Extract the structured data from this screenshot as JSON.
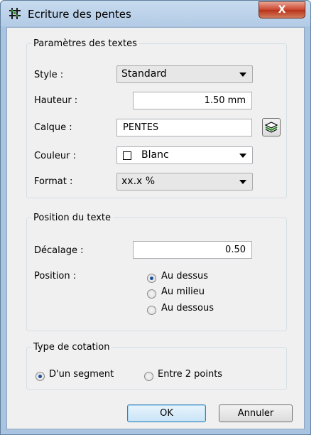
{
  "window": {
    "title": "Ecriture des pentes",
    "close_label": "X"
  },
  "params": {
    "legend": "Paramètres des textes",
    "style_label": "Style :",
    "style_value": "Standard",
    "hauteur_label": "Hauteur :",
    "hauteur_value": "1.50 mm",
    "calque_label": "Calque :",
    "calque_value": "PENTES",
    "couleur_label": "Couleur :",
    "couleur_value": "Blanc",
    "format_label": "Format :",
    "format_value": "xx.x %"
  },
  "position": {
    "legend": "Position du texte",
    "decalage_label": "Décalage :",
    "decalage_value": "0.50",
    "position_label": "Position :",
    "options": [
      "Au dessus",
      "Au milieu",
      "Au dessous"
    ],
    "selected": "Au dessus"
  },
  "cotation": {
    "legend": "Type de cotation",
    "options": [
      "D'un segment",
      "Entre 2 points"
    ],
    "selected": "D'un segment"
  },
  "buttons": {
    "ok": "OK",
    "cancel": "Annuler"
  },
  "colors": {
    "accent": "#1b4f9c",
    "title_bar": "#b3cbe6",
    "close": "#c9442d"
  }
}
